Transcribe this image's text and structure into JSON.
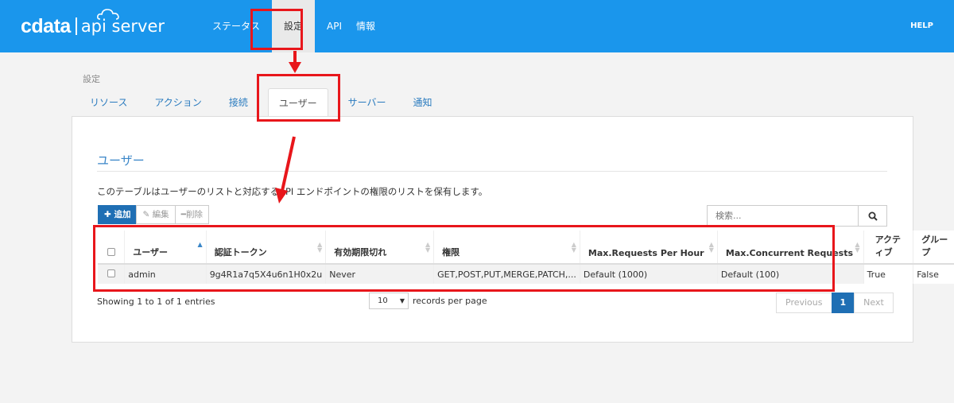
{
  "header": {
    "logo_main": "cdata",
    "logo_sub": "api server",
    "nav": [
      {
        "label": "ステータス"
      },
      {
        "label": "設定"
      },
      {
        "label": "API"
      },
      {
        "label": "情報"
      }
    ],
    "help": "HELP",
    "bar_color": "#1a96ec"
  },
  "breadcrumb": "設定",
  "tabs": [
    {
      "label": "リソース"
    },
    {
      "label": "アクション"
    },
    {
      "label": "接続"
    },
    {
      "label": "ユーザー"
    },
    {
      "label": "サーバー"
    },
    {
      "label": "通知"
    }
  ],
  "panel": {
    "title": "ユーザー",
    "description": "このテーブルはユーザーのリストと対応するAPI エンドポイントの権限のリストを保有します。",
    "buttons": {
      "add": "✚ 追加",
      "edit": "編集",
      "delete": "削除"
    },
    "search_placeholder": "検索..."
  },
  "table": {
    "columns": [
      "ユーザー",
      "認証トークン",
      "有効期限切れ",
      "権限",
      "Max.Requests Per Hour",
      "Max.Concurrent Requests",
      "アクティブ",
      "グループ"
    ],
    "rows": [
      [
        "admin",
        "9g4R1a7q5X4u6n1H0x2u",
        "Never",
        "GET,POST,PUT,MERGE,PATCH,...",
        "Default (1000)",
        "Default (100)",
        "True",
        "False"
      ]
    ]
  },
  "footer": {
    "info": "Showing 1 to 1 of 1 entries",
    "page_size": "10",
    "page_size_label": "records per page",
    "prev": "Previous",
    "current": "1",
    "next": "Next"
  },
  "annotation_color": "#e8161b"
}
